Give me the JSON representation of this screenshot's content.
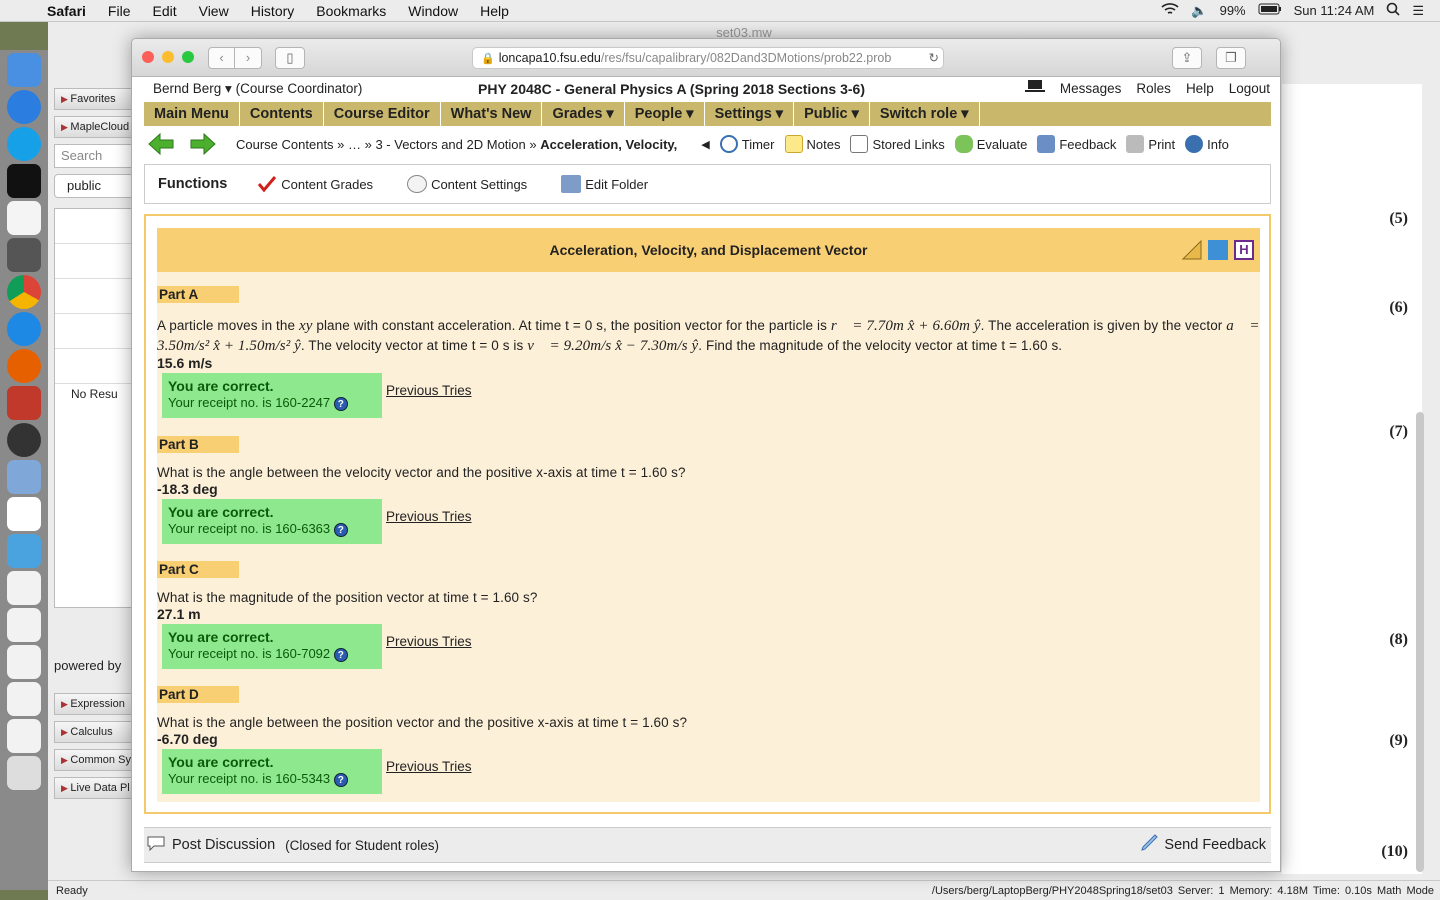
{
  "menubar": {
    "app": "Safari",
    "items": [
      "File",
      "Edit",
      "View",
      "History",
      "Bookmarks",
      "Window",
      "Help"
    ],
    "battery": "99%",
    "clock": "Sun 11:24 AM"
  },
  "maple": {
    "window_title": "set03.mw",
    "panels_top": [
      "Favorites",
      "MapleCloud"
    ],
    "search_placeholder": "Search",
    "public_select": "public",
    "no_results": "No Resu",
    "powered_by": "powered by",
    "panels_bottom": [
      "Expression",
      "Calculus",
      "Common Sy",
      "Live Data Pl"
    ],
    "equation_numbers": [
      "(5)",
      "(6)",
      "(7)",
      "(8)",
      "(9)",
      "(10)"
    ],
    "status_left": "Ready",
    "status_right": "/Users/berg/LaptopBerg/PHY2048Spring18/set03   Server: 1   Memory: 4.18M   Time: 0.10s   Math Mode"
  },
  "safari": {
    "url_domain": "loncapa10.fsu.edu",
    "url_path": "/res/fsu/capalibrary/082Dand3DMotions/prob22.prob"
  },
  "lc": {
    "user": "Bernd Berg ▾ (Course Coordinator)",
    "course": "PHY 2048C - General Physics A (Spring 2018 Sections 3-6)",
    "right_links": [
      "Messages",
      "Roles",
      "Help",
      "Logout"
    ],
    "menu": [
      "Main Menu",
      "Contents",
      "Course Editor",
      "What's New",
      "Grades ▾",
      "People ▾",
      "Settings ▾",
      "Public ▾",
      "Switch role ▾"
    ],
    "breadcrumb": {
      "start": "Course Contents »  … » 3 - Vectors and 2D Motion »",
      "current": "Acceleration, Velocity,"
    },
    "tools": [
      "Timer",
      "Notes",
      "Stored Links",
      "Evaluate",
      "Feedback",
      "Print",
      "Info"
    ],
    "functions": {
      "title": "Functions",
      "items": [
        "Content Grades",
        "Content Settings",
        "Edit Folder"
      ]
    },
    "problem_title": "Acceleration, Velocity, and Displacement Vector",
    "parts": [
      {
        "label": "Part A",
        "question": "",
        "answer": "15.6 m/s",
        "correct": "You are correct.",
        "receipt": "Your receipt no. is 160-2247",
        "previous": "Previous Tries"
      },
      {
        "label": "Part B",
        "question": "What is the angle between the velocity vector and the positive x-axis at time t = 1.60 s?",
        "answer": "-18.3 deg",
        "correct": "You are correct.",
        "receipt": "Your receipt no. is 160-6363",
        "previous": "Previous Tries"
      },
      {
        "label": "Part C",
        "question": "What is the magnitude of the position vector at time t = 1.60 s?",
        "answer": "27.1 m",
        "correct": "You are correct.",
        "receipt": "Your receipt no. is 160-7092",
        "previous": "Previous Tries"
      },
      {
        "label": "Part D",
        "question": "What is the angle between the position vector and the positive x-axis at time t = 1.60 s?",
        "answer": "-6.70 deg",
        "correct": "You are correct.",
        "receipt": "Your receipt no. is 160-5343",
        "previous": "Previous Tries"
      }
    ],
    "part_a_text": {
      "t1": "A particle moves in the ",
      "xy": "xy",
      "t2": " plane with constant acceleration. At time t = 0 s, the position vector for the particle is ",
      "r": "r⃗ = 7.70m x̂ + 6.60m ŷ",
      "t3": ". The acceleration is given by the vector ",
      "a": "a⃗ = 3.50m/s² x̂ + 1.50m/s² ŷ",
      "t4": ". The velocity vector at time t = 0 s is ",
      "v": "v⃗ = 9.20m/s x̂ − 7.30m/s ŷ",
      "t5": ". Find the magnitude of the velocity vector at time t = 1.60 s."
    },
    "footer": {
      "post": "Post Discussion",
      "closed": "(Closed for Student roles)",
      "send": "Send Feedback"
    }
  }
}
